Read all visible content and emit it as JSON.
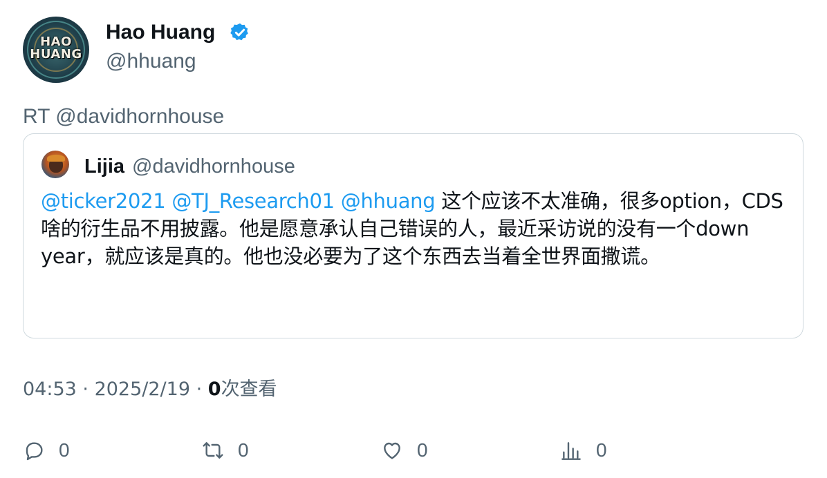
{
  "author": {
    "name": "Hao Huang",
    "handle": "@hhuang",
    "avatar_text": "HAO HUANG",
    "verified_color": "#1d9bf0"
  },
  "retweet_label": "RT @davidhornhouse",
  "quoted": {
    "name": "Lijia",
    "handle": "@davidhornhouse",
    "mentions": [
      "@ticker2021",
      "@TJ_Research01",
      "@hhuang"
    ],
    "text": " 这个应该不太准确，很多option，CDS啥的衍生品不用披露。他是愿意承认自己错误的人，最近采访说的没有一个down year，就应该是真的。他也没必要为了这个东西去当着全世界面撒谎。"
  },
  "meta": {
    "time": "04:53",
    "sep1": " · ",
    "date": "2025/2/19",
    "sep2": " · ",
    "views_count": "0",
    "views_label": "次查看"
  },
  "actions": {
    "reply": {
      "icon": "reply-icon",
      "count": "0"
    },
    "retweet": {
      "icon": "retweet-icon",
      "count": "0"
    },
    "like": {
      "icon": "heart-icon",
      "count": "0"
    },
    "views": {
      "icon": "analytics-icon",
      "count": "0"
    }
  },
  "colors": {
    "mention": "#1d9bf0",
    "secondary_text": "#536471",
    "primary_text": "#0f1419",
    "border": "#cfd9de"
  }
}
